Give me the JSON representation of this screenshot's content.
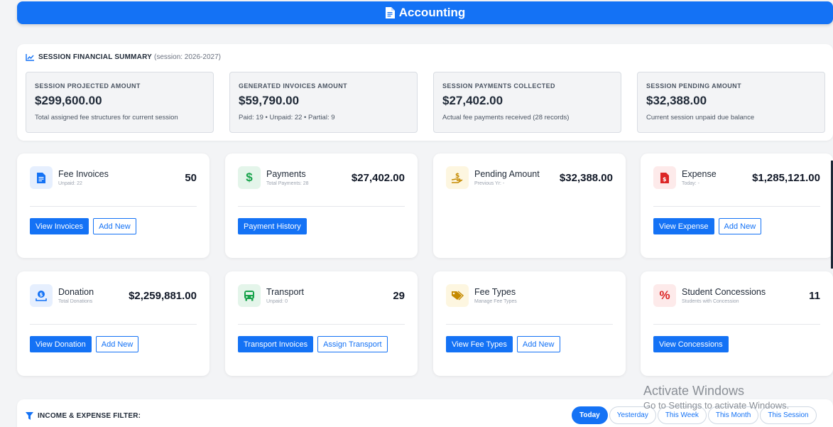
{
  "header": {
    "title": "Accounting"
  },
  "summary": {
    "title": "SESSION FINANCIAL SUMMARY",
    "session": "(session: 2026-2027)",
    "stats": [
      {
        "label": "SESSION PROJECTED AMOUNT",
        "value": "$299,600.00",
        "sub": "Total assigned fee structures for current session"
      },
      {
        "label": "GENERATED INVOICES AMOUNT",
        "value": "$59,790.00",
        "sub": "Paid: 19 • Unpaid: 22 • Partial: 9"
      },
      {
        "label": "SESSION PAYMENTS COLLECTED",
        "value": "$27,402.00",
        "sub": "Actual fee payments received (28 records)"
      },
      {
        "label": "SESSION PENDING AMOUNT",
        "value": "$32,388.00",
        "sub": "Current session unpaid due balance"
      }
    ]
  },
  "cards": [
    {
      "title": "Fee Invoices",
      "sub": "Unpaid: 22",
      "value": "50",
      "icon": "invoice-icon",
      "color": "#1472f5",
      "bg": "#e6effe",
      "btn1": "View Invoices",
      "btn2": "Add New"
    },
    {
      "title": "Payments",
      "sub": "Total Payments: 28",
      "value": "$27,402.00",
      "icon": "dollar-icon",
      "color": "#16a34a",
      "bg": "#e4f5ea",
      "btn1": "Payment History"
    },
    {
      "title": "Pending Amount",
      "sub": "Previous Yr: -",
      "value": "$32,388.00",
      "icon": "hand-coin-icon",
      "color": "#c58a00",
      "bg": "#fdf6e0"
    },
    {
      "title": "Expense",
      "sub": "Today: -",
      "value": "$1,285,121.00",
      "icon": "expense-file-icon",
      "color": "#dc2626",
      "bg": "#fdeaea",
      "btn1": "View Expense",
      "btn2": "Add New"
    },
    {
      "title": "Donation",
      "sub": "Total Donations",
      "value": "$2,259,881.00",
      "icon": "donation-icon",
      "color": "#1472f5",
      "bg": "#e6effe",
      "btn1": "View Donation",
      "btn2": "Add New"
    },
    {
      "title": "Transport",
      "sub": "Unpaid: 0",
      "value": "29",
      "icon": "bus-icon",
      "color": "#16a34a",
      "bg": "#e4f5ea",
      "btn1": "Transport Invoices",
      "btn2": "Assign Transport"
    },
    {
      "title": "Fee Types",
      "sub": "Manage Fee Types",
      "value": "",
      "icon": "tags-icon",
      "color": "#c58a00",
      "bg": "#fdf6e0",
      "btn1": "View Fee Types",
      "btn2": "Add New"
    },
    {
      "title": "Student Concessions",
      "sub": "Students with Concession",
      "value": "11",
      "icon": "percent-icon",
      "color": "#dc2626",
      "bg": "#fdeaea",
      "btn1": "View Concessions"
    }
  ],
  "filter": {
    "title": "INCOME & EXPENSE FILTER:",
    "options": [
      "Today",
      "Yesterday",
      "This Week",
      "This Month",
      "This Session"
    ],
    "selected": "Today"
  },
  "watermark": {
    "line1": "Activate Windows",
    "line2": "Go to Settings to activate Windows."
  }
}
